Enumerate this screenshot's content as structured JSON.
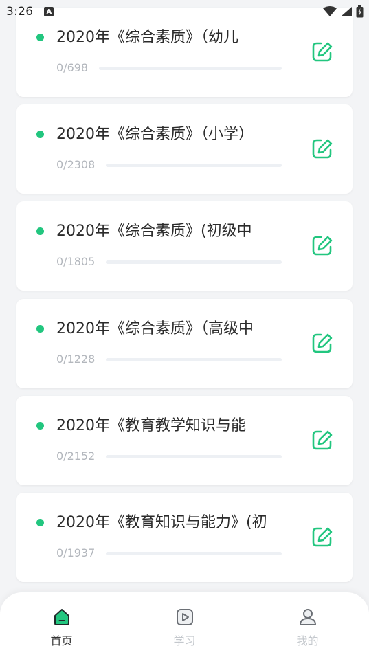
{
  "status_bar": {
    "time": "3:26",
    "notification_icon": "A",
    "icons": [
      "wifi-icon",
      "signal-icon",
      "battery-icon"
    ]
  },
  "cards": [
    {
      "title": "2020年《综合素质》（幼儿",
      "count": "0/698",
      "progress": 0
    },
    {
      "title": "2020年《综合素质》（小学）",
      "count": "0/2308",
      "progress": 0
    },
    {
      "title": "2020年《综合素质》(初级中",
      "count": "0/1805",
      "progress": 0
    },
    {
      "title": "2020年《综合素质》（高级中",
      "count": "0/1228",
      "progress": 0
    },
    {
      "title": "2020年《教育教学知识与能",
      "count": "0/2152",
      "progress": 0
    },
    {
      "title": "2020年《教育知识与能力》(初",
      "count": "0/1937",
      "progress": 0
    }
  ],
  "card_icon": "edit-icon",
  "bottom_nav": {
    "items": [
      {
        "label": "首页",
        "icon": "home-icon",
        "active": true
      },
      {
        "label": "学习",
        "icon": "play-icon",
        "active": false
      },
      {
        "label": "我的",
        "icon": "user-icon",
        "active": false
      }
    ]
  },
  "colors": {
    "accent": "#22c67f",
    "background": "#f3f4f6",
    "card": "#ffffff",
    "inactive": "#c4c8cd"
  }
}
